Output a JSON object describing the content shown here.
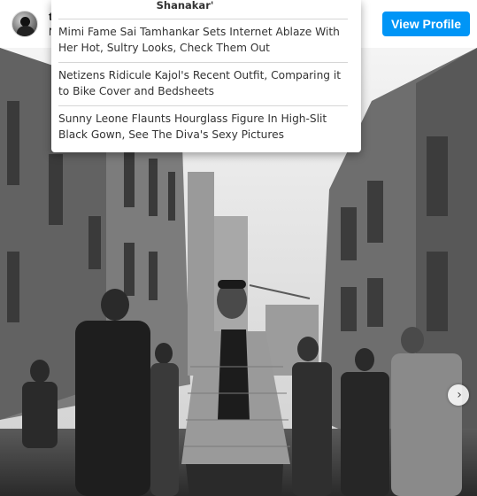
{
  "header": {
    "username": "t",
    "subname": "N",
    "view_profile_label": "View Profile"
  },
  "news_dropdown": {
    "title_fragment": "Shanakar'",
    "items": [
      {
        "headline": "Mimi Fame Sai Tamhankar Sets Internet Ablaze With Her Hot, Sultry Looks, Check Them Out"
      },
      {
        "headline": "Netizens Ridicule Kajol's Recent Outfit, Comparing it to Bike Cover and Bedsheets"
      },
      {
        "headline": "Sunny Leone Flaunts Hourglass Figure In High-Slit Black Gown, See The Diva's Sexy Pictures"
      }
    ]
  },
  "photo": {
    "description_icon": "street-photo",
    "next_icon": "chevron-right-icon"
  },
  "colors": {
    "accent": "#0095f6",
    "text": "#333333"
  }
}
